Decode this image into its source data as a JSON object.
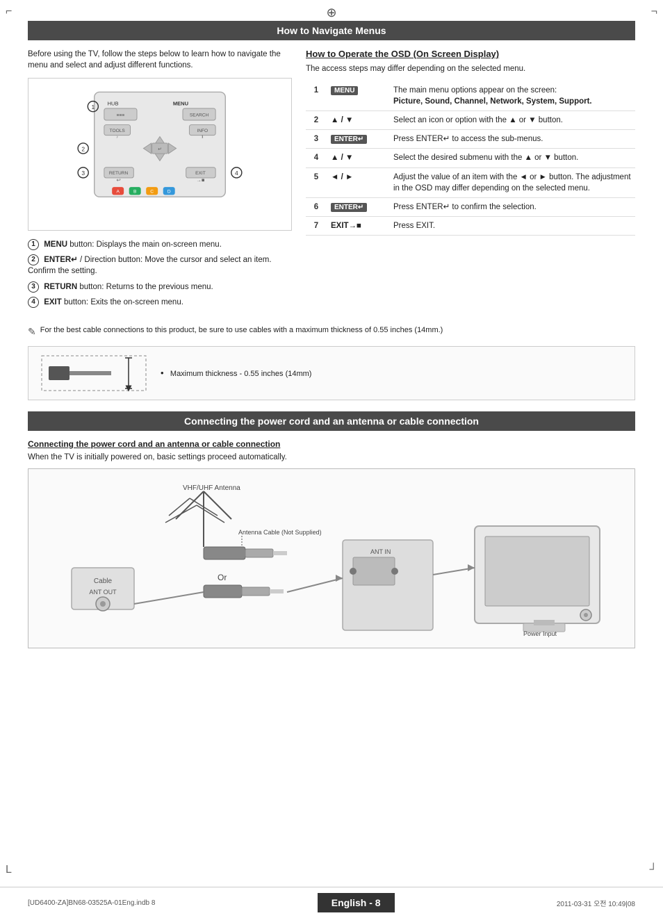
{
  "page": {
    "title": "How to Navigate Menus",
    "section2_title": "Connecting the power cord and an antenna or cable connection",
    "footer_file": "[UD6400-ZA]BN68-03525A-01Eng.indb   8",
    "footer_date": "2011-03-31   오전 10:49|08",
    "page_number": "English - 8"
  },
  "navigate_section": {
    "intro": "Before using the TV, follow the steps below to learn how to navigate the menu and select and adjust different functions.",
    "buttons": [
      {
        "num": "1",
        "label": "MENU",
        "desc": "button: Displays the main on-screen menu."
      },
      {
        "num": "2",
        "label": "ENTER",
        "suffix": " / Direction button: Move the cursor and select an item. Confirm the setting."
      },
      {
        "num": "3",
        "label": "RETURN",
        "desc": "button: Returns to the previous menu."
      },
      {
        "num": "4",
        "label": "EXIT",
        "desc": "button: Exits the on-screen menu."
      }
    ]
  },
  "osd_section": {
    "title": "How to Operate the OSD (On Screen Display)",
    "subtitle": "The access steps may differ depending on the selected menu.",
    "rows": [
      {
        "num": "1",
        "key": "MENU",
        "desc": "The main menu options appear on the screen:",
        "bold": "Picture, Sound, Channel, Network, System, Support."
      },
      {
        "num": "2",
        "key": "▲ / ▼",
        "desc": "Select an icon or option with the ▲ or ▼ button."
      },
      {
        "num": "3",
        "key": "ENTER ↵",
        "desc": "Press ENTER ↵ to access the sub-menus."
      },
      {
        "num": "4",
        "key": "▲ / ▼",
        "desc": "Select the desired submenu with the ▲ or ▼ button."
      },
      {
        "num": "5",
        "key": "◄ / ►",
        "desc": "Adjust the value of an item with the ◄ or ► button. The adjustment in the OSD may differ depending on the selected menu."
      },
      {
        "num": "6",
        "key": "ENTER ↵",
        "desc": "Press ENTER ↵ to confirm the selection."
      },
      {
        "num": "7",
        "key": "EXIT →■",
        "desc": "Press EXIT."
      }
    ]
  },
  "cable_note": {
    "text": "For the best cable connections to this product, be sure to use cables with a maximum thickness of 0.55 inches (14mm.)"
  },
  "cable_diagram": {
    "bullet": "Maximum thickness - 0.55 inches (14mm)"
  },
  "connecting_section": {
    "subtitle": "Connecting the power cord and an antenna or cable connection",
    "body": "When the TV is initially powered on, basic settings proceed automatically.",
    "labels": {
      "cable": "Cable",
      "ant_out": "ANT OUT",
      "vhf_uhf": "VHF/UHF Antenna",
      "antenna_cable": "Antenna Cable (Not Supplied)",
      "or": "Or",
      "ant_in": "ANT IN",
      "power_input": "Power Input"
    }
  }
}
